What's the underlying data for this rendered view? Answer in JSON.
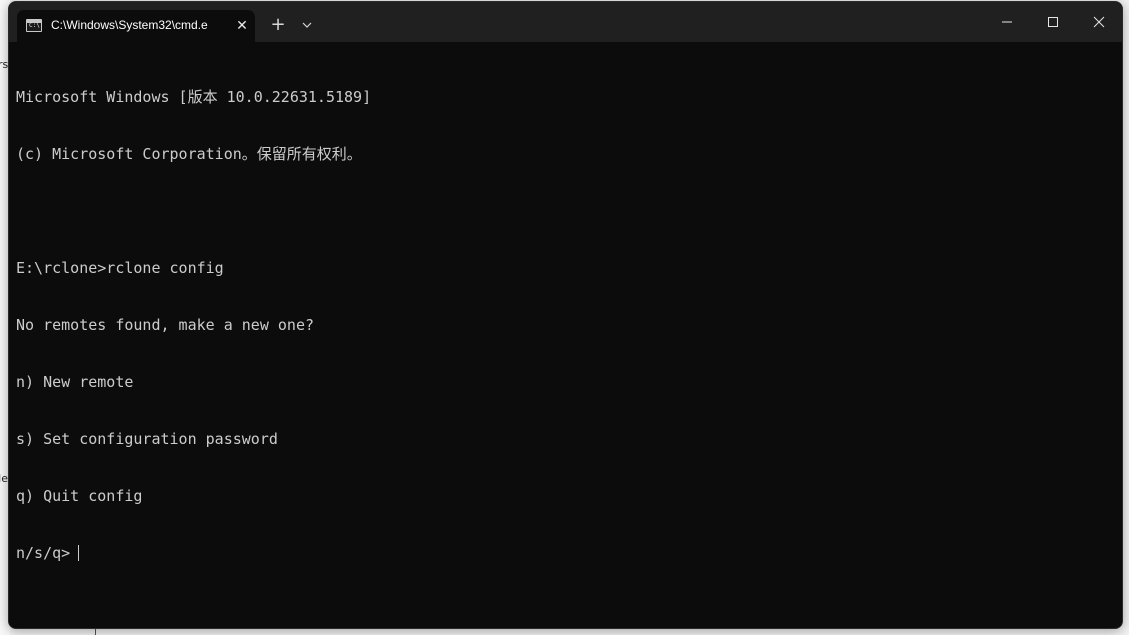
{
  "tab": {
    "title": "C:\\Windows\\System32\\cmd.e",
    "icon": "cmd-icon",
    "icon_label": "C:\\"
  },
  "titlebar": {
    "close_tab_glyph": "✕",
    "new_tab_glyph": "+",
    "minimize_icon": "minimize-icon",
    "maximize_icon": "maximize-icon",
    "close_icon": "close-icon"
  },
  "console": {
    "lines": [
      "Microsoft Windows [版本 10.0.22631.5189]",
      "(c) Microsoft Corporation。保留所有权利。",
      "",
      "E:\\rclone>rclone config",
      "No remotes found, make a new one?",
      "n) New remote",
      "s) Set configuration password",
      "q) Quit config"
    ],
    "prompt": "n/s/q>"
  },
  "background": {
    "left_text_1": "rs",
    "left_text_2": "Ie"
  },
  "colors": {
    "terminal_bg": "#0c0c0c",
    "titlebar_bg": "#202020",
    "text": "#cccccc"
  }
}
